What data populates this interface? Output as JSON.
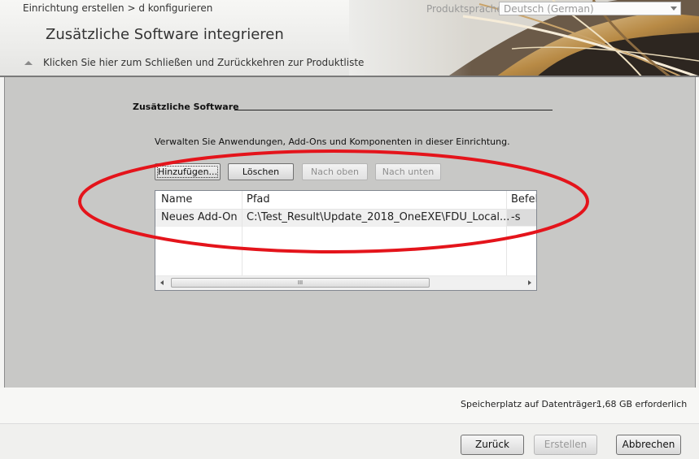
{
  "header": {
    "breadcrumb": "Einrichtung erstellen > d konfigurieren",
    "language_label": "Produktsprache:",
    "language_value": "Deutsch (German)",
    "title": "Zusätzliche Software integrieren",
    "collapse_link": "Klicken Sie hier zum Schließen und Zurückkehren zur Produktliste"
  },
  "section": {
    "title": "Zusätzliche Software",
    "description": "Verwalten Sie Anwendungen, Add-Ons und Komponenten in dieser Einrichtung."
  },
  "toolbar": {
    "add": "Hinzufügen...",
    "delete": "Löschen",
    "move_up": "Nach oben",
    "move_down": "Nach unten"
  },
  "table": {
    "columns": [
      "Name",
      "Pfad",
      "Befel"
    ],
    "rows": [
      {
        "name": "Neues Add-On",
        "path": "C:\\Test_Result\\Update_2018_OneEXE\\FDU_Local...",
        "command": "-s"
      }
    ],
    "scroll_thumb": "III"
  },
  "footer": {
    "disk_label": "Speicherplatz auf Datenträger:",
    "disk_value": "1,68 GB erforderlich",
    "back": "Zurück",
    "create": "Erstellen",
    "cancel": "Abbrechen"
  },
  "colors": {
    "annotation": "#e4141b",
    "panel": "#c8c8c6"
  }
}
